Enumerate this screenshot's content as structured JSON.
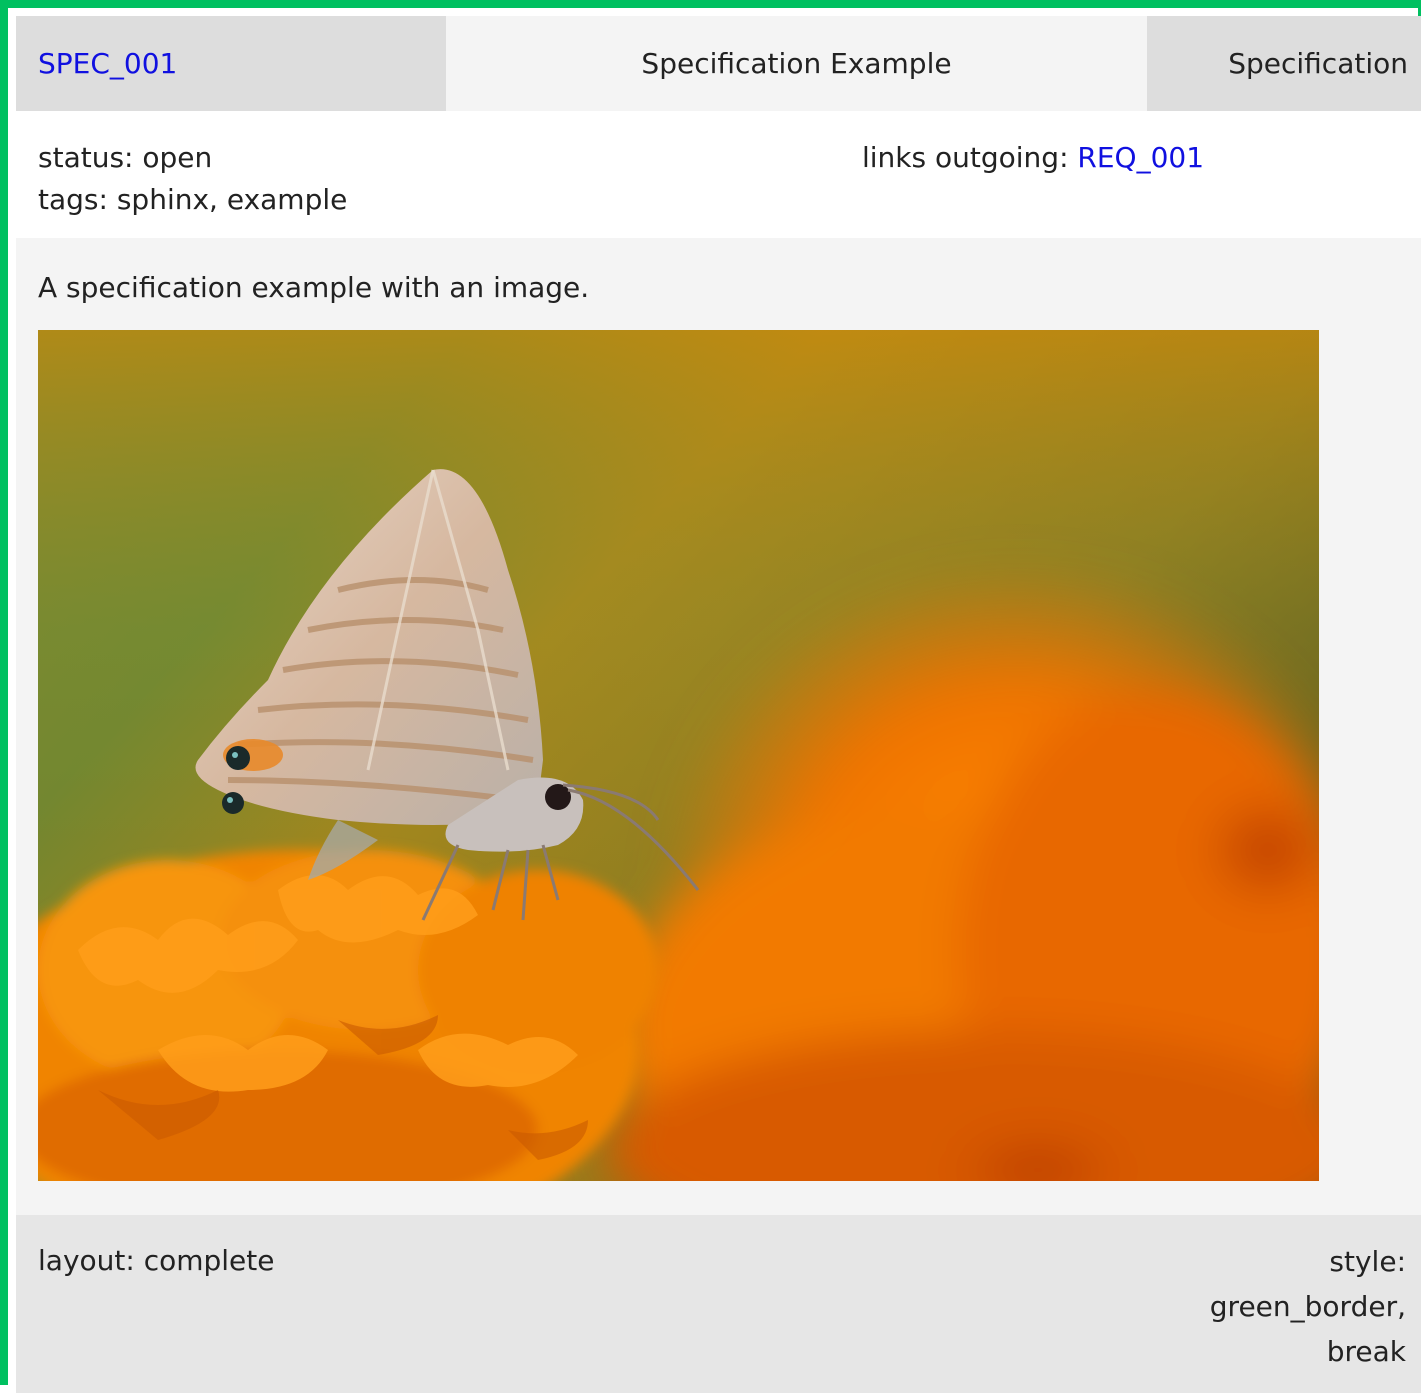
{
  "header": {
    "id": "SPEC_001",
    "title": "Specification Example",
    "type": "Specification"
  },
  "meta": {
    "status_label": "status:",
    "status_value": "open",
    "tags_label": "tags:",
    "tags_value": "sphinx, example",
    "links_label": "links outgoing:",
    "links_value": "REQ_001"
  },
  "content": {
    "description": "A specification example with an image.",
    "image": "butterfly-on-orange-marigold-photo"
  },
  "footer": {
    "layout_label": "layout:",
    "layout_value": "complete",
    "style_label": "style:",
    "style_line1": "green_border,",
    "style_line2": "break"
  },
  "colors": {
    "border": "#00c060",
    "link": "#1010e0",
    "header_gray": "#dddddd",
    "header_light": "#f4f4f4",
    "footer_gray": "#e6e6e6"
  }
}
